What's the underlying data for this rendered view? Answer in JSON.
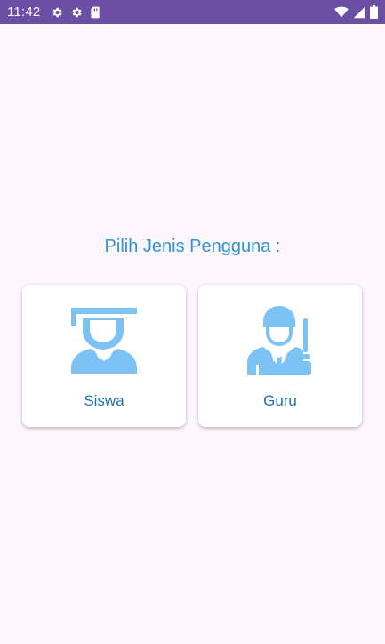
{
  "status_bar": {
    "time": "11:42",
    "left_icons": [
      "gear-icon",
      "gear-icon",
      "sd-card-icon"
    ],
    "right_icons": [
      "wifi-icon",
      "cellular-signal-icon",
      "battery-icon"
    ],
    "background_color": "#6a4fa5"
  },
  "main": {
    "title": "Pilih Jenis Pengguna :",
    "title_color": "#2f93d6",
    "options": [
      {
        "label": "Siswa",
        "icon": "student-graduate-icon"
      },
      {
        "label": "Guru",
        "icon": "teacher-icon"
      }
    ],
    "icon_color": "#7cc2f4",
    "label_color": "#1f6fb2"
  }
}
